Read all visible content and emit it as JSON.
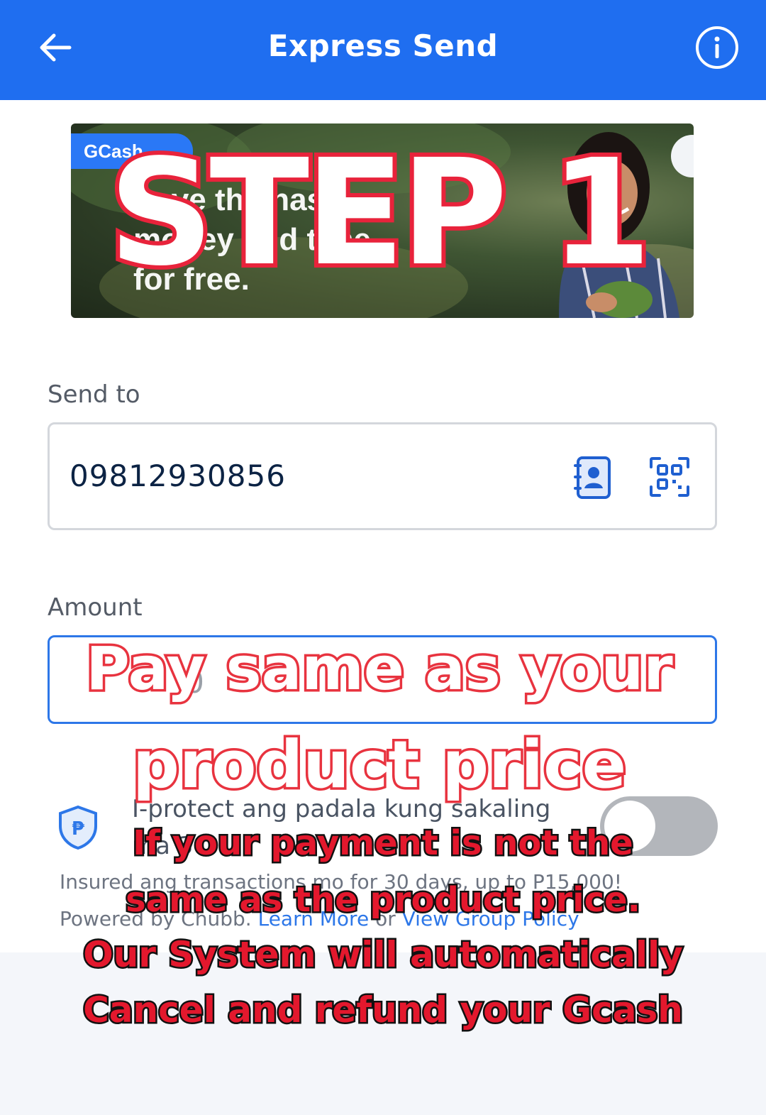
{
  "header": {
    "title": "Express Send"
  },
  "banner": {
    "brand": "GCash",
    "promo": "Save the hassle,\nmoney and time\nfor free."
  },
  "overlay": {
    "step": "STEP 1",
    "pay_line1": "Pay same as your",
    "pay_line2": "product price",
    "warn_line1": "If your payment is not the",
    "warn_line2": "same as the product price.",
    "warn_line3": "Our System will automatically",
    "warn_line4": "Cancel and refund your Gcash"
  },
  "send_to": {
    "label": "Send to",
    "value": "09812930856"
  },
  "amount": {
    "label": "Amount",
    "value": "0"
  },
  "protect": {
    "line1": "I-protect ang padala kung sakaling",
    "line2": "ma 3",
    "insured": "Insured ang transactions mo for 30 days, up to P15,000!",
    "powered_prefix": "Powered by Chubb.",
    "learn_more": "Learn More",
    "or": "or",
    "view_policy": "View Group Policy",
    "toggle_on": false
  },
  "colors": {
    "header_bg": "#1f6ef0",
    "accent": "#2d77e8",
    "overlay_stroke": "#e8233b"
  }
}
